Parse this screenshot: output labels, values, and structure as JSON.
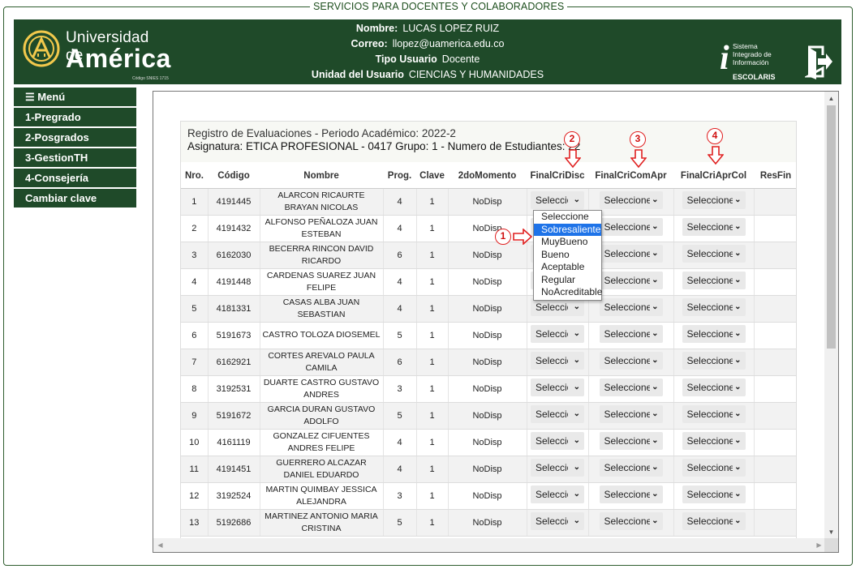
{
  "page": {
    "title": "SERVICIOS PARA DOCENTES Y COLABORADORES"
  },
  "header": {
    "logo_line1": "Universidad de",
    "logo_line2": "América",
    "logo_code": "Código SNIES 1715",
    "name_label": "Nombre:",
    "name_value": "LUCAS LOPEZ RUIZ",
    "email_label": "Correo:",
    "email_value": "llopez@uamerica.edu.co",
    "type_label": "Tipo Usuario",
    "type_value": "Docente",
    "unit_label": "Unidad del Usuario",
    "unit_value": "CIENCIAS Y HUMANIDADES",
    "system_line1": "Sistema",
    "system_line2": "Integrado de",
    "system_line3": "Información",
    "system_name": "ESCOLARIS",
    "brand_color": "#1f4a29"
  },
  "menu": {
    "items": [
      {
        "label": "☰ Menú"
      },
      {
        "label": "1-Pregrado"
      },
      {
        "label": "2-Posgrados"
      },
      {
        "label": "3-GestionTH"
      },
      {
        "label": "4-Consejería"
      },
      {
        "label": "Cambiar clave"
      }
    ]
  },
  "caption": {
    "line1": "Registro de Evaluaciones - Periodo Académico: 2022-2",
    "line2": "Asignatura: ETICA PROFESIONAL - 0417 Grupo: 1 - Numero de Estudiantes:  22"
  },
  "table": {
    "headers": [
      "Nro.",
      "Código",
      "Nombre",
      "Prog.",
      "Clave",
      "2doMomento",
      "FinalCriDisc",
      "FinalCriComApr",
      "FinalCriAprCol",
      "ResFin"
    ],
    "select_placeholder": "Seleccione",
    "rows": [
      {
        "nro": "1",
        "codigo": "4191445",
        "nombre": "ALARCON RICAURTE BRAYAN NICOLAS",
        "prog": "4",
        "clave": "1",
        "momento": "NoDisp"
      },
      {
        "nro": "2",
        "codigo": "4191432",
        "nombre": "ALFONSO PEÑALOZA JUAN ESTEBAN",
        "prog": "4",
        "clave": "1",
        "momento": "NoDisp"
      },
      {
        "nro": "3",
        "codigo": "6162030",
        "nombre": "BECERRA RINCON DAVID RICARDO",
        "prog": "6",
        "clave": "1",
        "momento": "NoDisp"
      },
      {
        "nro": "4",
        "codigo": "4191448",
        "nombre": "CARDENAS SUAREZ JUAN FELIPE",
        "prog": "4",
        "clave": "1",
        "momento": "NoDisp"
      },
      {
        "nro": "5",
        "codigo": "4181331",
        "nombre": "CASAS ALBA JUAN SEBASTIAN",
        "prog": "4",
        "clave": "1",
        "momento": "NoDisp"
      },
      {
        "nro": "6",
        "codigo": "5191673",
        "nombre": "CASTRO TOLOZA DIOSEMEL",
        "prog": "5",
        "clave": "1",
        "momento": "NoDisp"
      },
      {
        "nro": "7",
        "codigo": "6162921",
        "nombre": "CORTES AREVALO PAULA CAMILA",
        "prog": "6",
        "clave": "1",
        "momento": "NoDisp"
      },
      {
        "nro": "8",
        "codigo": "3192531",
        "nombre": "DUARTE CASTRO GUSTAVO ANDRES",
        "prog": "3",
        "clave": "1",
        "momento": "NoDisp"
      },
      {
        "nro": "9",
        "codigo": "5191672",
        "nombre": "GARCIA DURAN GUSTAVO ADOLFO",
        "prog": "5",
        "clave": "1",
        "momento": "NoDisp"
      },
      {
        "nro": "10",
        "codigo": "4161119",
        "nombre": "GONZALEZ CIFUENTES ANDRES FELIPE",
        "prog": "4",
        "clave": "1",
        "momento": "NoDisp"
      },
      {
        "nro": "11",
        "codigo": "4191451",
        "nombre": "GUERRERO ALCAZAR DANIEL EDUARDO",
        "prog": "4",
        "clave": "1",
        "momento": "NoDisp"
      },
      {
        "nro": "12",
        "codigo": "3192524",
        "nombre": "MARTIN QUIMBAY JESSICA ALEJANDRA",
        "prog": "3",
        "clave": "1",
        "momento": "NoDisp"
      },
      {
        "nro": "13",
        "codigo": "5192686",
        "nombre": "MARTINEZ ANTONIO MARIA CRISTINA",
        "prog": "5",
        "clave": "1",
        "momento": "NoDisp"
      }
    ]
  },
  "dropdown": {
    "options": [
      "Seleccione",
      "Sobresaliente",
      "MuyBueno",
      "Bueno",
      "Aceptable",
      "Regular",
      "NoAcreditable"
    ],
    "highlighted": "Sobresaliente",
    "highlight_color": "#1e73e8"
  },
  "annotations": {
    "marks": [
      "1",
      "2",
      "3",
      "4"
    ],
    "color": "#e02020"
  }
}
